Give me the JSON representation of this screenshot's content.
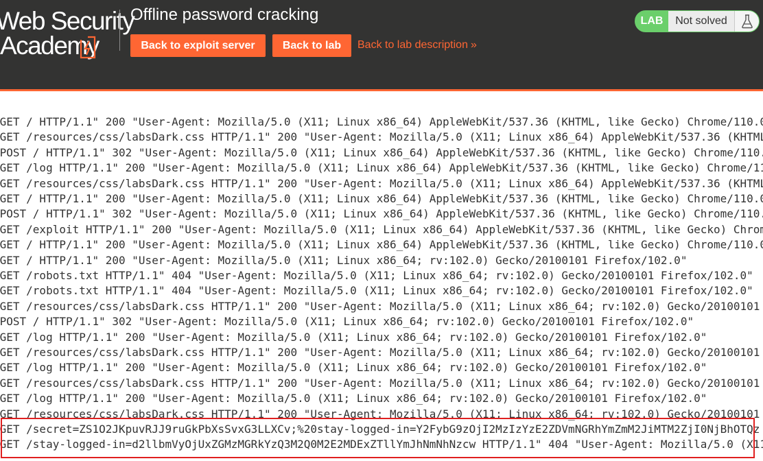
{
  "header": {
    "logo_line1": "Web Security",
    "logo_line2": "Academy",
    "title": "Offline password cracking",
    "buttons": {
      "exploit_server": "Back to exploit server",
      "lab": "Back to lab"
    },
    "lab_description_link": "Back to lab description",
    "chevron_glyph": "»",
    "lab_badge": {
      "label": "LAB",
      "status": "Not solved",
      "icon": "flask-icon"
    }
  },
  "colors": {
    "header_bg": "#333332",
    "accent": "#ff6633",
    "lab_green": "#6bcf6b",
    "highlight_border": "#e02020"
  },
  "log": {
    "lines": [
      "\"GET / HTTP/1.1\" 200 \"User-Agent: Mozilla/5.0 (X11; Linux x86_64) AppleWebKit/537.36 (KHTML, like Gecko) Chrome/110.0",
      "\"GET /resources/css/labsDark.css HTTP/1.1\" 200 \"User-Agent: Mozilla/5.0 (X11; Linux x86_64) AppleWebKit/537.36 (KHTML,",
      "\"POST / HTTP/1.1\" 302 \"User-Agent: Mozilla/5.0 (X11; Linux x86_64) AppleWebKit/537.36 (KHTML, like Gecko) Chrome/110.",
      "\"GET /log HTTP/1.1\" 200 \"User-Agent: Mozilla/5.0 (X11; Linux x86_64) AppleWebKit/537.36 (KHTML, like Gecko) Chrome/11",
      "\"GET /resources/css/labsDark.css HTTP/1.1\" 200 \"User-Agent: Mozilla/5.0 (X11; Linux x86_64) AppleWebKit/537.36 (KHTML,",
      "\"GET / HTTP/1.1\" 200 \"User-Agent: Mozilla/5.0 (X11; Linux x86_64) AppleWebKit/537.36 (KHTML, like Gecko) Chrome/110.0",
      "\"POST / HTTP/1.1\" 302 \"User-Agent: Mozilla/5.0 (X11; Linux x86_64) AppleWebKit/537.36 (KHTML, like Gecko) Chrome/110.",
      "\"GET /exploit HTTP/1.1\" 200 \"User-Agent: Mozilla/5.0 (X11; Linux x86_64) AppleWebKit/537.36 (KHTML, like Gecko) Chrom",
      "\"GET / HTTP/1.1\" 200 \"User-Agent: Mozilla/5.0 (X11; Linux x86_64) AppleWebKit/537.36 (KHTML, like Gecko) Chrome/110.0",
      "\"GET / HTTP/1.1\" 200 \"User-Agent: Mozilla/5.0 (X11; Linux x86_64; rv:102.0) Gecko/20100101 Firefox/102.0\"",
      "\"GET /robots.txt HTTP/1.1\" 404 \"User-Agent: Mozilla/5.0 (X11; Linux x86_64; rv:102.0) Gecko/20100101 Firefox/102.0\"",
      "\"GET /robots.txt HTTP/1.1\" 404 \"User-Agent: Mozilla/5.0 (X11; Linux x86_64; rv:102.0) Gecko/20100101 Firefox/102.0\"",
      "\"GET /resources/css/labsDark.css HTTP/1.1\" 200 \"User-Agent: Mozilla/5.0 (X11; Linux x86_64; rv:102.0) Gecko/20100101",
      "\"POST / HTTP/1.1\" 302 \"User-Agent: Mozilla/5.0 (X11; Linux x86_64; rv:102.0) Gecko/20100101 Firefox/102.0\"",
      "\"GET /log HTTP/1.1\" 200 \"User-Agent: Mozilla/5.0 (X11; Linux x86_64; rv:102.0) Gecko/20100101 Firefox/102.0\"",
      "\"GET /resources/css/labsDark.css HTTP/1.1\" 200 \"User-Agent: Mozilla/5.0 (X11; Linux x86_64; rv:102.0) Gecko/20100101",
      "\"GET /log HTTP/1.1\" 200 \"User-Agent: Mozilla/5.0 (X11; Linux x86_64; rv:102.0) Gecko/20100101 Firefox/102.0\"",
      "\"GET /resources/css/labsDark.css HTTP/1.1\" 200 \"User-Agent: Mozilla/5.0 (X11; Linux x86_64; rv:102.0) Gecko/20100101",
      "\"GET /log HTTP/1.1\" 200 \"User-Agent: Mozilla/5.0 (X11; Linux x86_64; rv:102.0) Gecko/20100101 Firefox/102.0\"",
      "\"GET /resources/css/labsDark.css HTTP/1.1\" 200 \"User-Agent: Mozilla/5.0 (X11; Linux x86_64; rv:102.0) Gecko/20100101",
      "\"GET /secret=ZS1O2JKpuvRJJ9ruGkPbXsSvxG3LLXCv;%20stay-logged-in=Y2FybG9zOjI2MzIzYzE2ZDVmNGRhYmZmM2JiMTM2ZjI0NjBhOTQz",
      "\"GET /stay-logged-in=d2llbmVyOjUxZGMzMGRkYzQ3M2Q0M2E2MDExZTllYmJhNmNhNzcw HTTP/1.1\" 404 \"User-Agent: Mozilla/5.0 (X11"
    ]
  }
}
